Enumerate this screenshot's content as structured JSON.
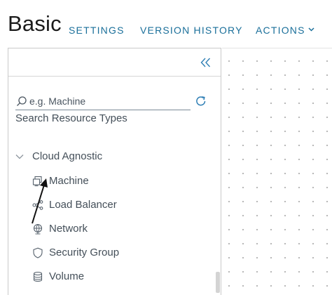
{
  "header": {
    "title": "Basic",
    "nav": {
      "settings": "SETTINGS",
      "version_history": "VERSION HISTORY",
      "actions": "ACTIONS"
    }
  },
  "palette": {
    "collapse_icon": "double-chevron-left-icon",
    "search": {
      "placeholder": "e.g. Machine",
      "value": "",
      "help_text": "Search Resource Types"
    },
    "category": {
      "label": "Cloud Agnostic",
      "expanded": true,
      "items": [
        {
          "label": "Machine",
          "icon": "machine-icon"
        },
        {
          "label": "Load Balancer",
          "icon": "load-balancer-icon"
        },
        {
          "label": "Network",
          "icon": "network-icon"
        },
        {
          "label": "Security Group",
          "icon": "security-group-icon"
        },
        {
          "label": "Volume",
          "icon": "volume-icon"
        }
      ]
    }
  },
  "colors": {
    "nav_link": "#1a6f9a",
    "text": "#444f59",
    "canvas_dot": "#b5b5b5"
  }
}
